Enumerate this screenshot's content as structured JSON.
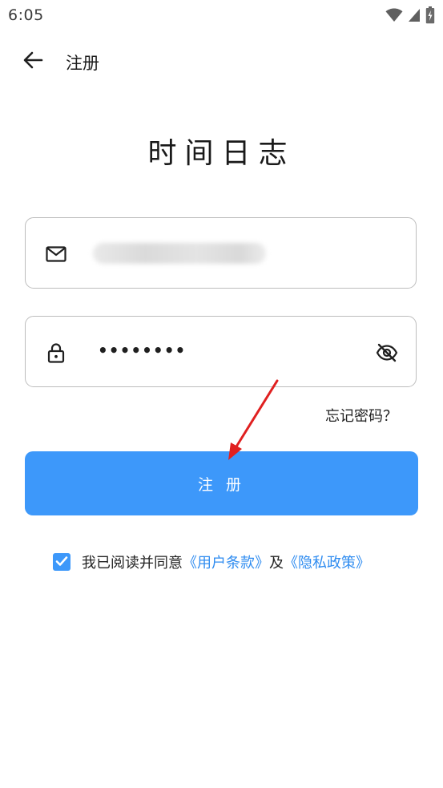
{
  "status_bar": {
    "time": "6:05",
    "icons": [
      "wifi-icon",
      "signal-icon",
      "battery-charging-icon"
    ]
  },
  "app_bar": {
    "back_icon": "arrow-left-icon",
    "title": "注册"
  },
  "app_name": "时间日志",
  "email_field": {
    "icon": "mail-icon",
    "value": "",
    "obscured": true
  },
  "password_field": {
    "icon": "lock-icon",
    "masked_value": "••••••••",
    "toggle_icon": "eye-off-icon"
  },
  "forgot_password": "忘记密码？",
  "register_button": "注 册",
  "agreement": {
    "checked": true,
    "prefix": "我已阅读并同意",
    "terms_link": "《用户条款》",
    "conjunction": "及",
    "privacy_link": "《隐私政策》"
  },
  "colors": {
    "primary": "#3d98fa",
    "link": "#2f8cf0",
    "annotation": "#e02020"
  }
}
